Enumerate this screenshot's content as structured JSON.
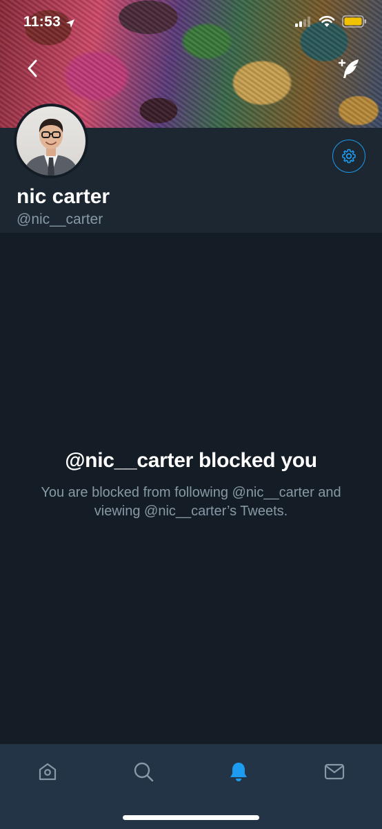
{
  "status_bar": {
    "time": "11:53",
    "icons": [
      "location-arrow-icon",
      "cellular-signal-icon",
      "wifi-icon",
      "battery-icon"
    ]
  },
  "header": {
    "back_icon": "chevron-left-icon",
    "compose_icon": "compose-feather-icon",
    "settings_icon": "gear-icon"
  },
  "profile": {
    "display_name": "nic carter",
    "handle": "@nic__carter"
  },
  "blocked": {
    "title": "@nic__carter blocked you",
    "description": "You are blocked from following @nic__carter and viewing @nic__carter’s Tweets."
  },
  "tab_bar": {
    "items": [
      {
        "icon": "home-icon",
        "active": false
      },
      {
        "icon": "search-icon",
        "active": false
      },
      {
        "icon": "bell-icon",
        "active": true
      },
      {
        "icon": "mail-icon",
        "active": false
      }
    ]
  },
  "colors": {
    "background": "#141d26",
    "header_bg": "#1c2732",
    "tab_bar_bg": "#243447",
    "accent": "#1d9bf0",
    "secondary_text": "#8899a6"
  }
}
